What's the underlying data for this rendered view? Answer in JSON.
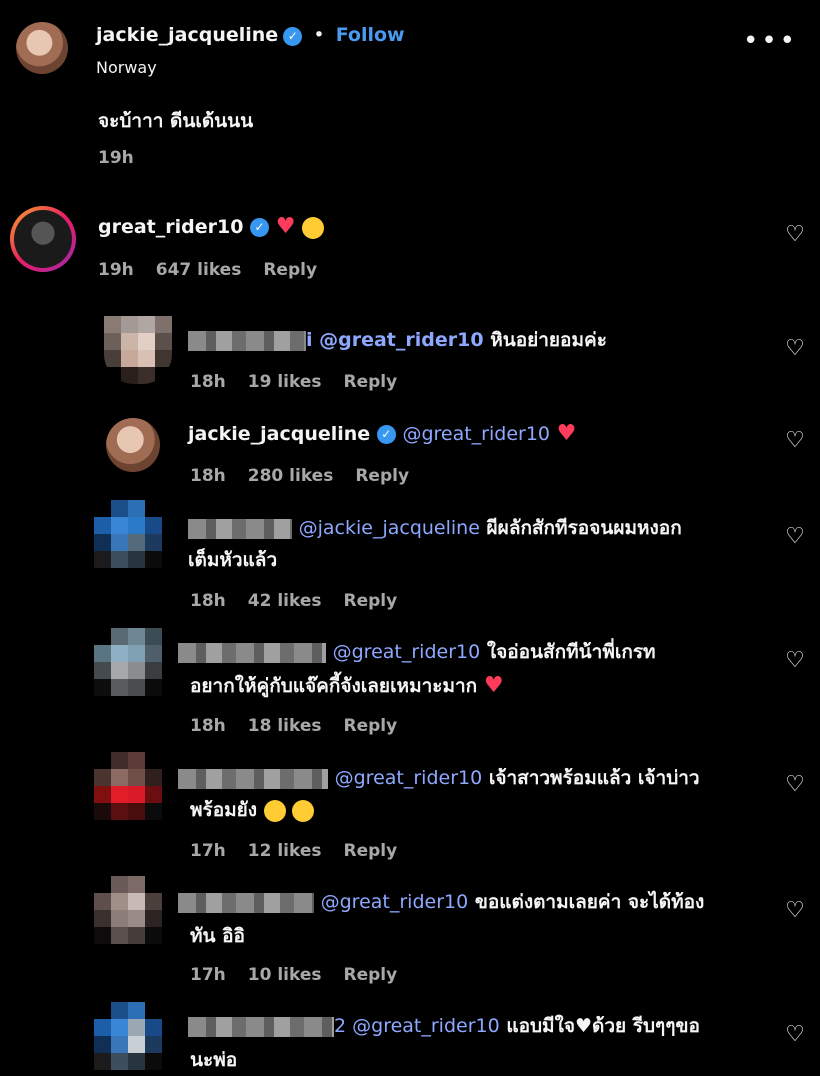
{
  "post": {
    "username": "jackie_jacqueline",
    "follow_label": "Follow",
    "location": "Norway",
    "caption": "จะบ้าาา ดีนเด้นนน",
    "time": "19h"
  },
  "comments": [
    {
      "username": "great_rider10",
      "text": "",
      "time": "19h",
      "likes": "647 likes",
      "reply": "Reply"
    },
    {
      "mention": "i @great_rider10",
      "text": "หินอย่ายอมค่ะ",
      "time": "18h",
      "likes": "19 likes",
      "reply": "Reply"
    },
    {
      "username": "jackie_jacqueline",
      "mention": "@great_rider10",
      "time": "18h",
      "likes": "280 likes",
      "reply": "Reply"
    },
    {
      "mention": "@jackie_jacqueline",
      "text": "ผีผลักสักทีรอจนผมหงอก",
      "text2": "เต็มหัวแล้ว",
      "time": "18h",
      "likes": "42 likes",
      "reply": "Reply"
    },
    {
      "mention": "@great_rider10",
      "text": "ใจอ่อนสักทีน้าพี่เกรท",
      "text2": "อยากให้คู่กับแจ๊คกี้จังเลยเหมาะมาก",
      "time": "18h",
      "likes": "18 likes",
      "reply": "Reply"
    },
    {
      "mention": "@great_rider10",
      "text": "เจ้าสาวพร้อมแล้ว เจ้าบ่าว",
      "text2": "พร้อมยัง",
      "time": "17h",
      "likes": "12 likes",
      "reply": "Reply"
    },
    {
      "mention": "@great_rider10",
      "text": "ขอแต่งตามเลยค่า จะได้ท้อง",
      "text2": "ทัน อิอิ",
      "time": "17h",
      "likes": "10 likes",
      "reply": "Reply"
    },
    {
      "mention": "2 @great_rider10",
      "text": "แอบมีใจ",
      "text_b": "ด้วย รีบๆๆขอ",
      "text2": "นะพ่อ"
    }
  ],
  "colors": {
    "mention": "#8ea8ff",
    "verified": "#3897f0",
    "heart": "#ff3b5c"
  }
}
